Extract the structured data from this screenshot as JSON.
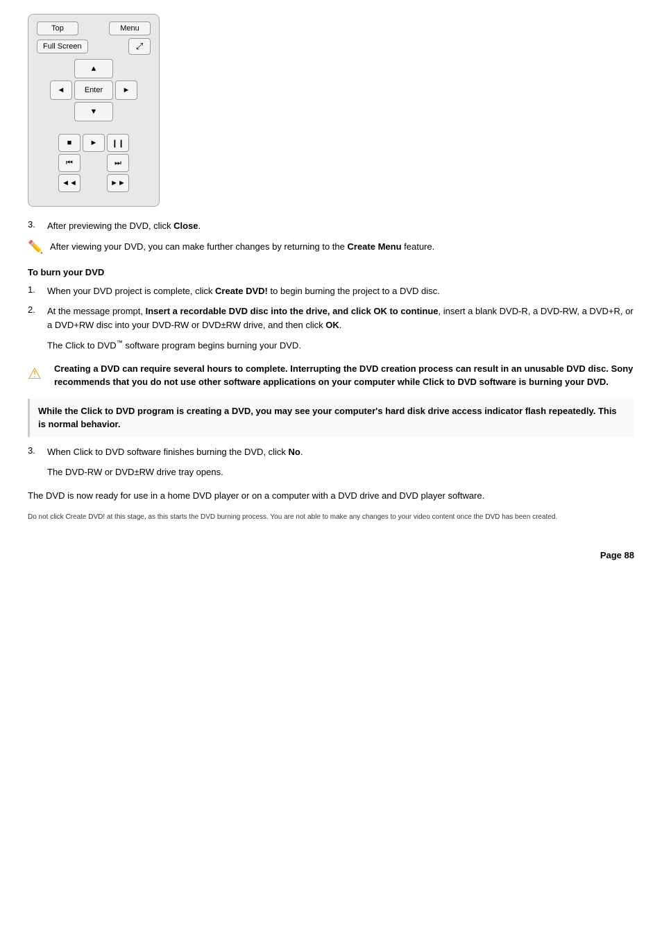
{
  "remote": {
    "btn_top": "Top",
    "btn_menu": "Menu",
    "btn_fullscreen": "Full Screen",
    "btn_angle": "⤢",
    "btn_up": "▲",
    "btn_down": "▼",
    "btn_left": "◄",
    "btn_right": "►",
    "btn_enter": "Enter",
    "btn_stop": "■",
    "btn_play": "►",
    "btn_pause": "❙❙",
    "btn_prev_chapter": "⏮",
    "btn_next_chapter": "⏭",
    "btn_rewind": "◄◄",
    "btn_fastforward": "►►"
  },
  "steps": {
    "step3_label": "3.",
    "step3_text1": "After previewing the DVD, click ",
    "step3_bold": "Close",
    "step3_end": ".",
    "note_text": "After viewing your DVD, you can make further changes by returning to the ",
    "note_bold": "Create Menu",
    "note_end": " feature.",
    "section_heading": "To burn your DVD",
    "burn_step1_num": "1.",
    "burn_step1_text1": "When your DVD project is complete, click ",
    "burn_step1_bold": "Create DVD!",
    "burn_step1_text2": " to begin burning the project to a DVD disc.",
    "burn_step2_num": "2.",
    "burn_step2_text1": "At the message prompt, ",
    "burn_step2_bold": "Insert a recordable DVD disc into the drive, and click OK to continue",
    "burn_step2_text2": ", insert a blank DVD-R, a DVD-RW, a DVD+R, or a DVD+RW disc into your DVD-RW or DVD±RW drive, and then click ",
    "burn_step2_bold2": "OK",
    "burn_step2_end": ".",
    "indent1_text1": "The Click to DVD",
    "indent1_logo": "™",
    "indent1_text2": " software program begins burning your DVD.",
    "warning_text": "Creating a DVD can require several hours to complete. Interrupting the DVD creation process can result in an unusable DVD disc. Sony recommends that you do not use other software applications on your computer while Click to DVD software is burning your DVD.",
    "info_text1": "While the Click to DVD program is creating a DVD, you may see your computer's hard disk drive access indicator flash repeatedly. This is normal behavior.",
    "burn_step3_num": "3.",
    "burn_step3_text1": "When Click to DVD software finishes burning the DVD, click ",
    "burn_step3_bold": "No",
    "burn_step3_end": ".",
    "indent2_text": "The DVD-RW or DVD±RW drive tray opens.",
    "final_text": "The DVD is now ready for use in a home DVD player or on a computer with a DVD drive and DVD player software.",
    "small_note": "Do not click Create DVD! at this stage, as this starts the DVD burning process. You are not able to make any changes to your video content once the DVD has been created.",
    "page_num": "Page 88"
  }
}
